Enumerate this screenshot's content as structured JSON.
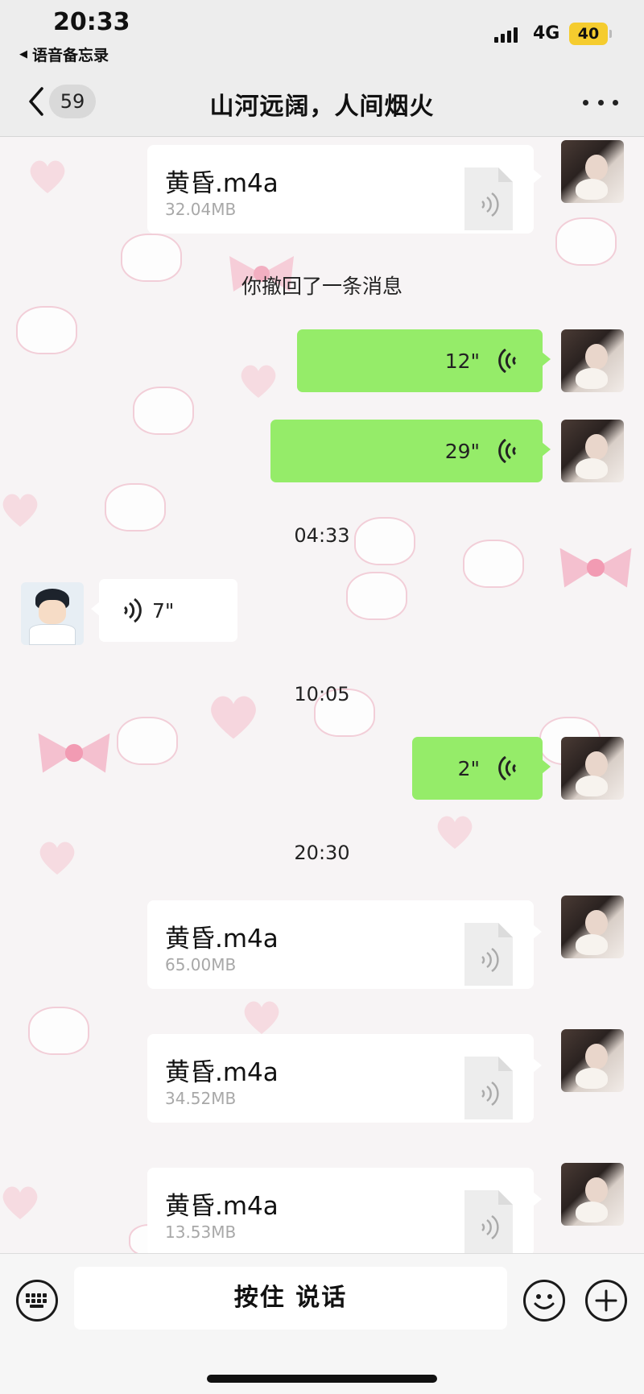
{
  "status_bar": {
    "time": "20:33",
    "back_app_label": "语音备忘录",
    "network": "4G",
    "battery": "40",
    "battery_color": "#f5cc2e"
  },
  "nav": {
    "unread_count": "59",
    "title": "山河远阔，人间烟火",
    "back_icon": "chevron-left-icon",
    "more_icon": "more-dots-icon"
  },
  "messages": {
    "file1": {
      "name": "黄昏.m4a",
      "size": "32.04MB"
    },
    "recall_notice": "你撤回了一条消息",
    "voice1": {
      "duration": "12\""
    },
    "voice2": {
      "duration": "29\""
    },
    "time1": "04:33",
    "voice3": {
      "duration": "7\""
    },
    "time2": "10:05",
    "voice4": {
      "duration": "2\""
    },
    "time3": "20:30",
    "file2": {
      "name": "黄昏.m4a",
      "size": "65.00MB"
    },
    "file3": {
      "name": "黄昏.m4a",
      "size": "34.52MB"
    },
    "file4": {
      "name": "黄昏.m4a",
      "size": "13.53MB"
    }
  },
  "input_bar": {
    "hold_to_talk": "按住 说话",
    "keyboard_icon": "keyboard-icon",
    "emoji_icon": "emoji-icon",
    "plus_icon": "plus-icon"
  },
  "colors": {
    "my_bubble": "#95ec69",
    "other_bubble": "#ffffff",
    "header_bg": "#ededed"
  }
}
